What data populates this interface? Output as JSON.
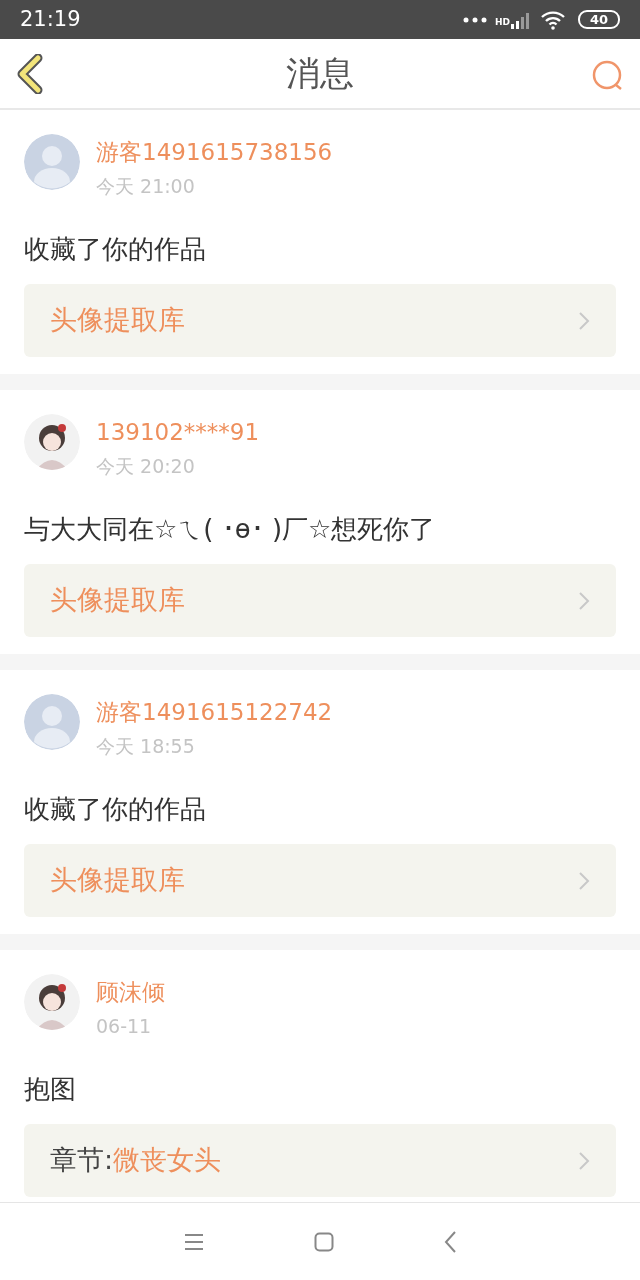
{
  "status_bar": {
    "time": "21:19",
    "network": "HD",
    "battery": "40"
  },
  "header": {
    "title": "消息"
  },
  "messages": [
    {
      "avatar": {
        "kind": "default"
      },
      "name": "游客1491615738156",
      "time": "今天 21:00",
      "text": "收藏了你的作品",
      "link": {
        "title": "头像提取库"
      }
    },
    {
      "name": "139102****91",
      "time": "今天 20:20",
      "text": "与大大同在☆ㄟ( ･ө･ )厂☆想死你了",
      "link": {
        "title": "头像提取库"
      }
    },
    {
      "avatar": {
        "kind": "default"
      },
      "name": "游客1491615122742",
      "time": "今天 18:55",
      "text": "收藏了你的作品",
      "link": {
        "title": "头像提取库"
      }
    },
    {
      "name": "顾沫倾",
      "time": "06-11",
      "text": "抱图",
      "link": {
        "prefix": "章节:",
        "title": "微丧女头"
      }
    }
  ]
}
